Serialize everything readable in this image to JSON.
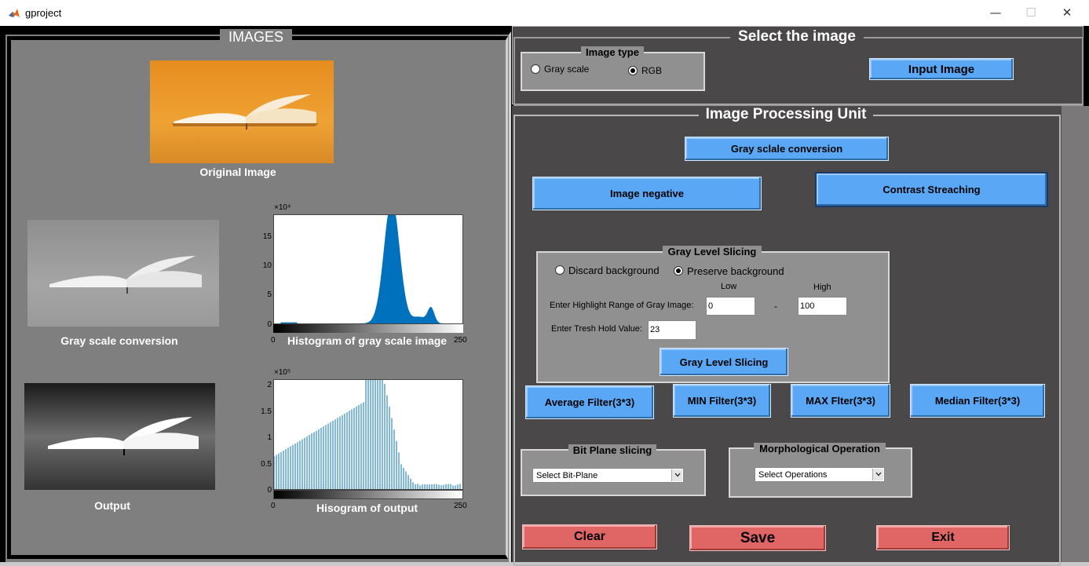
{
  "window": {
    "title": "gproject",
    "minimize_glyph": "—",
    "maximize_glyph": "☐",
    "close_glyph": "✕"
  },
  "images_panel": {
    "title": "IMAGES",
    "original_caption": "Original Image",
    "gray_caption": "Gray scale conversion",
    "output_caption": "Output",
    "hist1": {
      "exponent": "×10⁴",
      "yticks": [
        "15",
        "10",
        "5",
        "0"
      ],
      "x_min": "0",
      "x_max": "250",
      "caption": "Histogram of gray scale image",
      "bar_color": "#0072bd"
    },
    "hist2": {
      "exponent": "×10⁵",
      "yticks": [
        "2",
        "1.5",
        "1",
        "0.5",
        "0"
      ],
      "x_min": "0",
      "x_max": "250",
      "caption": "Hisogram of output",
      "bar_color": "#0072bd"
    }
  },
  "select_panel": {
    "title": "Select the image",
    "image_type": {
      "title": "Image type",
      "option_gray": "Gray scale",
      "option_rgb": "RGB",
      "selected": "RGB"
    },
    "input_button": "Input Image"
  },
  "ipu": {
    "title": "Image Processing Unit",
    "gray_conv_button": "Gray sclale conversion",
    "negative_button": "Image negative",
    "contrast_button": "Contrast Streaching",
    "gls": {
      "title": "Gray Level Slicing",
      "discard": "Discard background",
      "preserve": "Preserve background",
      "selected": "Preserve background",
      "low_label": "Low",
      "high_label": "High",
      "range_label": "Enter Highlight Range of Gray Image:",
      "dash": "-",
      "low_value": "0",
      "high_value": "100",
      "thresh_label": "Enter Tresh Hold Value:",
      "thresh_value": "23",
      "button": "Gray Level Slicing"
    },
    "avg_button": "Average Filter(3*3)",
    "min_button": "MIN Filter(3*3)",
    "max_button": "MAX Flter(3*3)",
    "median_button": "Median Filter(3*3)",
    "bitplane": {
      "title": "Bit Plane slicing",
      "selected": "Select Bit-Plane"
    },
    "morph": {
      "title": "Morphological Operation",
      "selected": "Select Operations"
    },
    "clear_button": "Clear",
    "save_button": "Save",
    "exit_button": "Exit"
  },
  "colors": {
    "button_blue": "#5aa8f5",
    "button_red": "#e06666",
    "panel_dark": "#4a4849",
    "panel_gray": "#7f7f7f"
  }
}
